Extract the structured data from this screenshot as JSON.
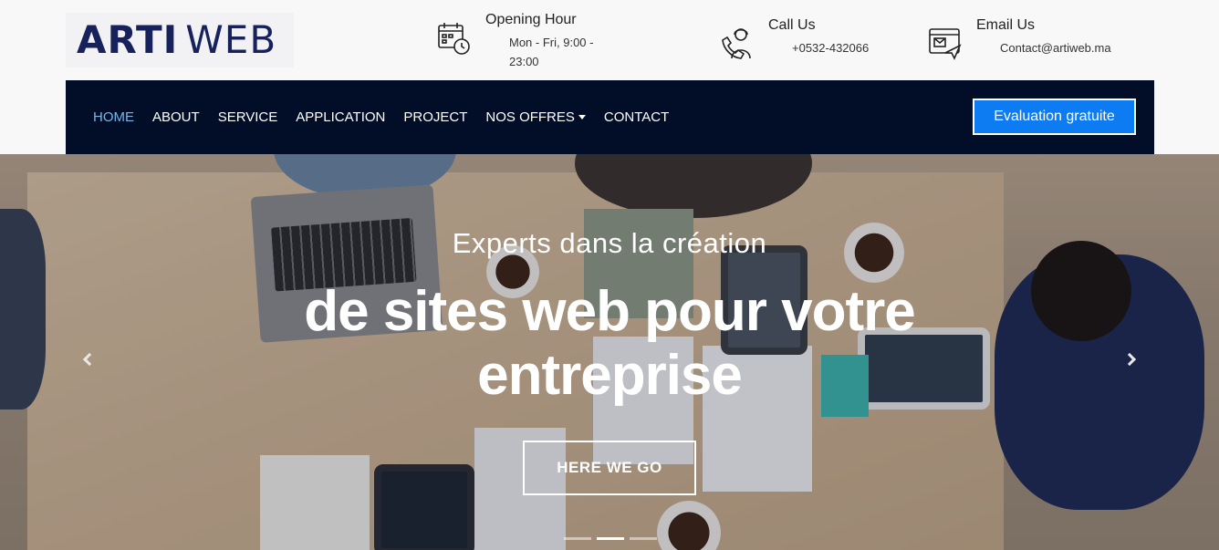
{
  "logo": {
    "part1": "ARTI",
    "part2": "WEB"
  },
  "contacts": [
    {
      "title": "Opening Hour",
      "value": "Mon - Fri, 9:00 - 23:00",
      "icon": "calendar-clock-icon"
    },
    {
      "title": "Call Us",
      "value": "+0532-432066",
      "icon": "support-agent-icon"
    },
    {
      "title": "Email Us",
      "value": "Contact@artiweb.ma",
      "icon": "email-send-icon"
    }
  ],
  "nav": {
    "items": [
      {
        "label": "HOME",
        "active": true
      },
      {
        "label": "ABOUT"
      },
      {
        "label": "SERVICE"
      },
      {
        "label": "APPLICATION"
      },
      {
        "label": "PROJECT"
      },
      {
        "label": "NOS OFFRES",
        "dropdown": true
      },
      {
        "label": "CONTACT"
      }
    ],
    "cta": "Evaluation gratuite"
  },
  "hero": {
    "subtitle": "Experts dans la création",
    "title": "de sites web pour votre entreprise",
    "button": "HERE WE GO",
    "slides": 3,
    "active_slide": 2
  },
  "colors": {
    "nav_bg": "#020e27",
    "nav_active": "#74b6f0",
    "cta_bg": "#0d7bf2",
    "logo": "#17215c"
  }
}
